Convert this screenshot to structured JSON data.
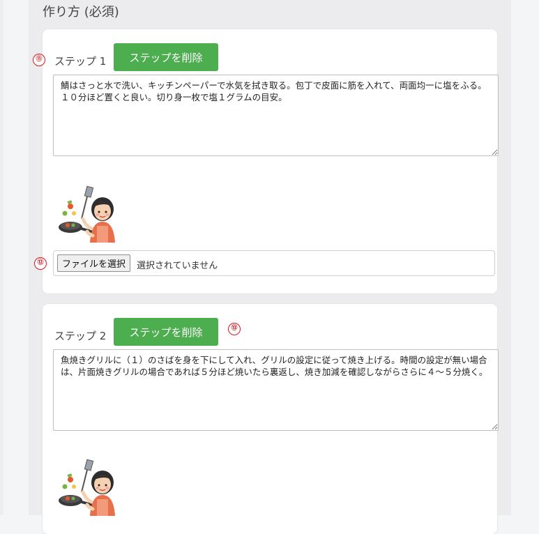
{
  "section": {
    "title": "作り方 (必須)"
  },
  "steps": [
    {
      "label": "ステップ 1",
      "delete_label": "ステップを削除",
      "text": "鯖はさっと水で洗い、キッチンペーパーで水気を拭き取る。包丁で皮面に筋を入れて、両面均一に塩をふる。１０分ほど置くと良い。切り身一枚で塩１グラムの目安。",
      "file_button_label": "ファイルを選択",
      "file_status": "選択されていません"
    },
    {
      "label": "ステップ 2",
      "delete_label": "ステップを削除",
      "text": "魚焼きグリルに（１）のさばを身を下にして入れ、グリルの設定に従って焼き上げる。時間の設定が無い場合は、片面焼きグリルの場合であれば５分ほど焼いたら裏返し、焼き加減を確認しながらさらに４～５分焼く。"
    }
  ],
  "annotations": {
    "marker_11": "⑪",
    "marker_12": "⑫",
    "marker_13": "⑬"
  },
  "colors": {
    "delete_button": "#4cae4f",
    "annotation_red": "#d9141b",
    "card_background": "#ffffff",
    "panel_background": "#ececee"
  },
  "icons": {
    "step_image": "cooking-woman-illustration"
  }
}
